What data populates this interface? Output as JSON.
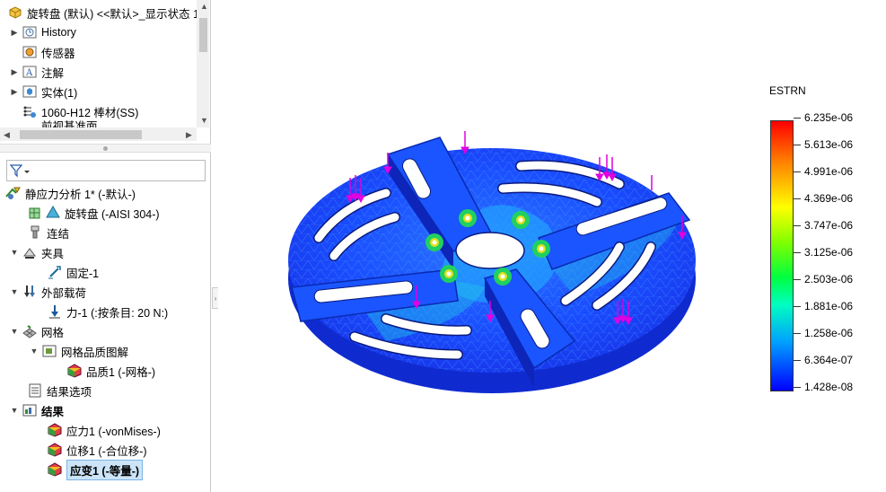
{
  "top_tree": {
    "title": "旋转盘 (默认) <<默认>_显示状态 1",
    "items": [
      {
        "label": "History",
        "icon": "history-icon"
      },
      {
        "label": "传感器",
        "icon": "sensor-icon"
      },
      {
        "label": "注解",
        "icon": "annotation-icon"
      },
      {
        "label": "实体(1)",
        "icon": "solid-bodies-icon"
      },
      {
        "label": "1060-H12 棒材(SS)",
        "icon": "material-icon"
      },
      {
        "label": "前视基准面",
        "icon": "plane-icon"
      }
    ]
  },
  "bottom_tree": {
    "items": [
      {
        "label": "静应力分析 1* (-默认-)",
        "icon": "static-study-icon"
      },
      {
        "label": "旋转盘 (-AISI 304-)",
        "icon": "part-icon"
      },
      {
        "label": "连结",
        "icon": "connections-icon"
      },
      {
        "label": "夹具",
        "icon": "fixtures-icon"
      },
      {
        "label": "固定-1",
        "icon": "fixed-geometry-icon"
      },
      {
        "label": "外部载荷",
        "icon": "external-loads-icon"
      },
      {
        "label": "力-1 (:按条目: 20 N:)",
        "icon": "force-icon"
      },
      {
        "label": "网格",
        "icon": "mesh-icon"
      },
      {
        "label": "网格品质图解",
        "icon": "folder-icon"
      },
      {
        "label": "品质1 (-网格-)",
        "icon": "mesh-quality-plot-icon"
      },
      {
        "label": "结果选项",
        "icon": "result-options-icon"
      },
      {
        "label": "结果",
        "icon": "results-folder-icon"
      },
      {
        "label": "应力1 (-vonMises-)",
        "icon": "stress-plot-icon"
      },
      {
        "label": "位移1 (-合位移-)",
        "icon": "displacement-plot-icon"
      },
      {
        "label": "应变1 (-等量-)",
        "icon": "strain-plot-icon"
      }
    ]
  },
  "legend": {
    "title": "ESTRN",
    "ticks": [
      "6.235e-06",
      "5.613e-06",
      "4.991e-06",
      "4.369e-06",
      "3.747e-06",
      "3.125e-06",
      "2.503e-06",
      "1.881e-06",
      "1.258e-06",
      "6.364e-07",
      "1.428e-08"
    ]
  },
  "colors": {
    "selection_bg": "#cce4f7",
    "load_arrow": "#e000e0",
    "mesh_base": "#1a3bff"
  }
}
